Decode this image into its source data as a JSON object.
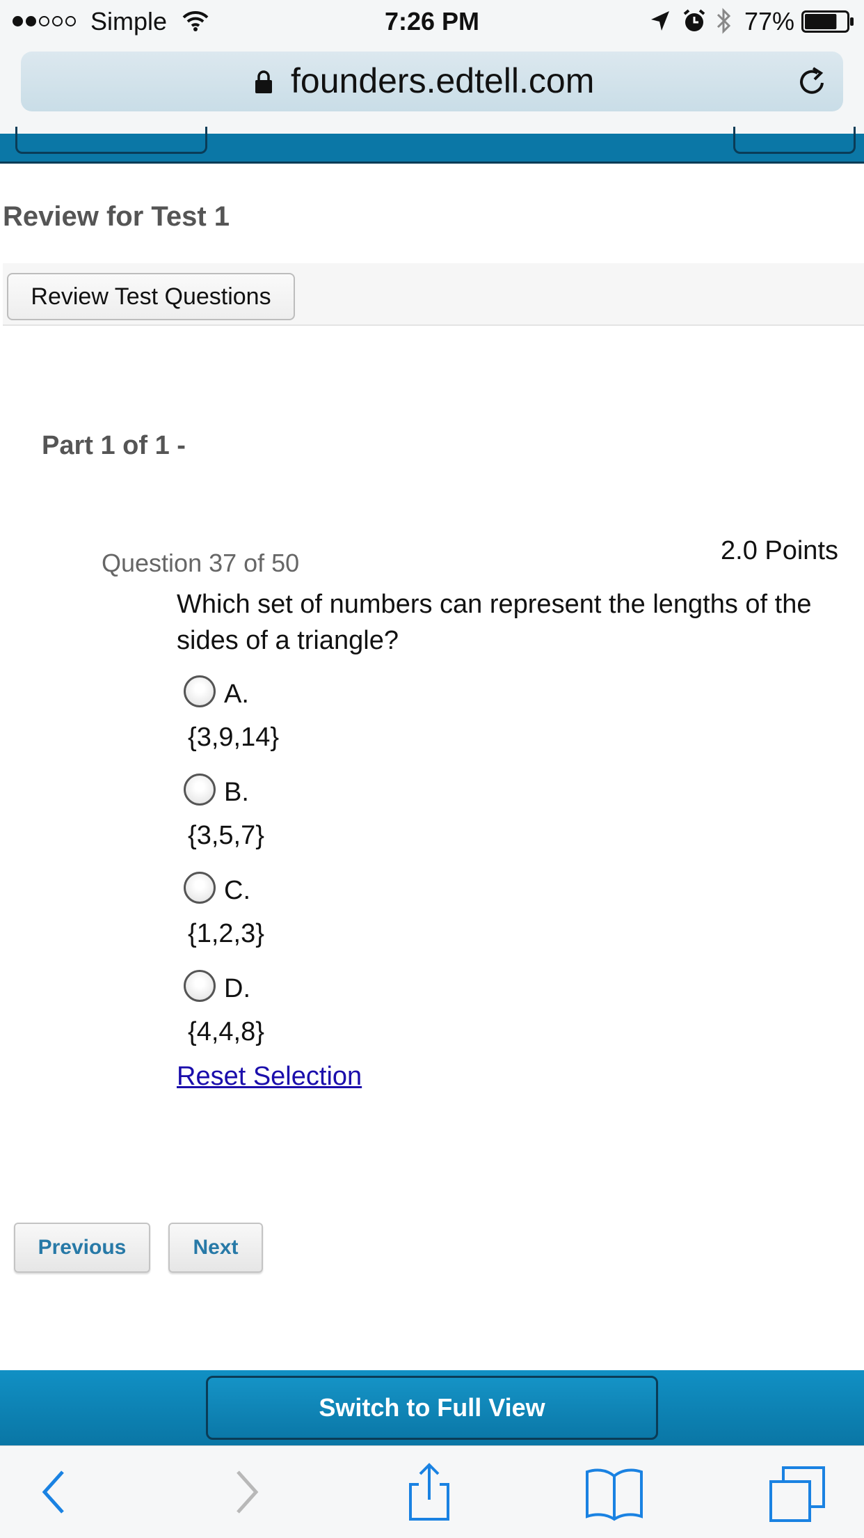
{
  "status_bar": {
    "carrier": "Simple",
    "time": "7:26 PM",
    "battery_percent": "77%",
    "battery_level": 0.77,
    "icons": [
      "signal-dots-icon",
      "wifi-icon",
      "location-arrow-icon",
      "alarm-icon",
      "bluetooth-icon",
      "battery-icon"
    ]
  },
  "browser": {
    "url": "founders.edtell.com",
    "icons": [
      "lock-icon",
      "reload-icon"
    ]
  },
  "page": {
    "title": "Review for Test 1",
    "review_button_label": "Review Test Questions",
    "part_label": "Part 1 of 1 -"
  },
  "question": {
    "number_label": "Question 37 of 50",
    "points": "2.0 Points",
    "text": "Which set of numbers can represent the lengths of the sides of a triangle?",
    "options": [
      {
        "letter": "A.",
        "value": "{3,9,14}"
      },
      {
        "letter": "B.",
        "value": "{3,5,7}"
      },
      {
        "letter": "C.",
        "value": "{1,2,3}"
      },
      {
        "letter": "D.",
        "value": "{4,4,8}"
      }
    ],
    "reset_label": "Reset Selection"
  },
  "navigation": {
    "previous_label": "Previous",
    "next_label": "Next"
  },
  "footer": {
    "full_view_label": "Switch to Full View"
  },
  "safari_toolbar": {
    "icons": [
      "back-icon",
      "forward-icon",
      "share-icon",
      "bookmarks-icon",
      "tabs-icon"
    ]
  },
  "colors": {
    "brand_blue": "#0b77a6",
    "link": "#1a0dab",
    "button_text": "#2779a7",
    "ios_blue": "#1a82e2"
  }
}
